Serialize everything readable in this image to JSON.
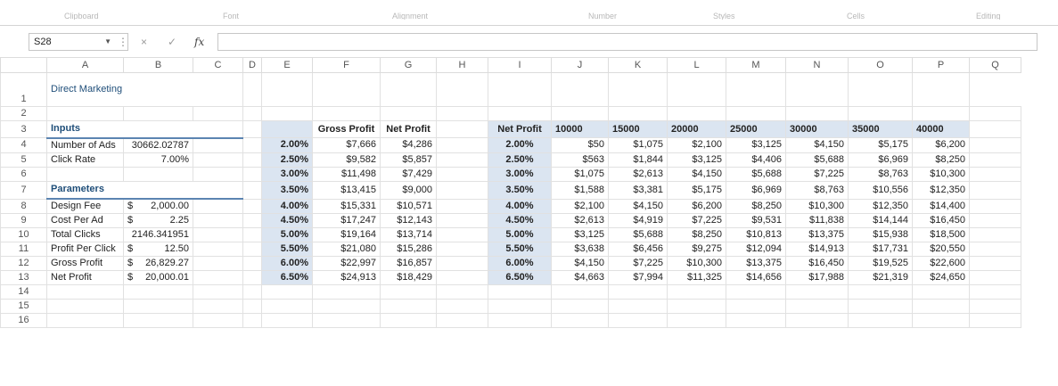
{
  "ribbon": {
    "groups": [
      "Clipboard",
      "Font",
      "Alignment",
      "Number",
      "Styles",
      "Cells",
      "Editing"
    ]
  },
  "formula_bar": {
    "name_box": "S28",
    "cancel_icon": "×",
    "enter_icon": "✓",
    "fx_label": "fx",
    "formula": ""
  },
  "columns": [
    "A",
    "B",
    "C",
    "D",
    "E",
    "F",
    "G",
    "H",
    "I",
    "J",
    "K",
    "L",
    "M",
    "N",
    "O",
    "P",
    "Q"
  ],
  "rows": [
    "1",
    "2",
    "3",
    "4",
    "5",
    "6",
    "7",
    "8",
    "9",
    "10",
    "11",
    "12",
    "13",
    "14",
    "15",
    "16"
  ],
  "title": "Direct Marketing",
  "inputs": {
    "heading": "Inputs",
    "items": [
      {
        "label": "Number of Ads",
        "currency": "",
        "value": "30662.02787"
      },
      {
        "label": "Click Rate",
        "currency": "",
        "value": "7.00%"
      }
    ]
  },
  "parameters": {
    "heading": "Parameters",
    "items": [
      {
        "label": "Design Fee",
        "currency": "$",
        "value": "2,000.00"
      },
      {
        "label": "Cost Per Ad",
        "currency": "$",
        "value": "2.25"
      },
      {
        "label": "Total Clicks",
        "currency": "",
        "value": "2146.341951"
      },
      {
        "label": "Profit Per Click",
        "currency": "$",
        "value": "12.50"
      },
      {
        "label": "Gross Profit",
        "currency": "$",
        "value": "26,829.27"
      },
      {
        "label": "Net Profit",
        "currency": "$",
        "value": "20,000.01"
      }
    ]
  },
  "one_way_table": {
    "headers": [
      "Gross Profit",
      "Net Profit"
    ],
    "rows": [
      {
        "rate": "2.00%",
        "gross": "$7,666",
        "net": "$4,286"
      },
      {
        "rate": "2.50%",
        "gross": "$9,582",
        "net": "$5,857"
      },
      {
        "rate": "3.00%",
        "gross": "$11,498",
        "net": "$7,429"
      },
      {
        "rate": "3.50%",
        "gross": "$13,415",
        "net": "$9,000"
      },
      {
        "rate": "4.00%",
        "gross": "$15,331",
        "net": "$10,571"
      },
      {
        "rate": "4.50%",
        "gross": "$17,247",
        "net": "$12,143"
      },
      {
        "rate": "5.00%",
        "gross": "$19,164",
        "net": "$13,714"
      },
      {
        "rate": "5.50%",
        "gross": "$21,080",
        "net": "$15,286"
      },
      {
        "rate": "6.00%",
        "gross": "$22,997",
        "net": "$16,857"
      },
      {
        "rate": "6.50%",
        "gross": "$24,913",
        "net": "$18,429"
      }
    ]
  },
  "two_way_table": {
    "corner": "Net Profit",
    "ads": [
      "10000",
      "15000",
      "20000",
      "25000",
      "30000",
      "35000",
      "40000"
    ],
    "rows": [
      {
        "rate": "2.00%",
        "values": [
          "$50",
          "$1,075",
          "$2,100",
          "$3,125",
          "$4,150",
          "$5,175",
          "$6,200"
        ]
      },
      {
        "rate": "2.50%",
        "values": [
          "$563",
          "$1,844",
          "$3,125",
          "$4,406",
          "$5,688",
          "$6,969",
          "$8,250"
        ]
      },
      {
        "rate": "3.00%",
        "values": [
          "$1,075",
          "$2,613",
          "$4,150",
          "$5,688",
          "$7,225",
          "$8,763",
          "$10,300"
        ]
      },
      {
        "rate": "3.50%",
        "values": [
          "$1,588",
          "$3,381",
          "$5,175",
          "$6,969",
          "$8,763",
          "$10,556",
          "$12,350"
        ]
      },
      {
        "rate": "4.00%",
        "values": [
          "$2,100",
          "$4,150",
          "$6,200",
          "$8,250",
          "$10,300",
          "$12,350",
          "$14,400"
        ]
      },
      {
        "rate": "4.50%",
        "values": [
          "$2,613",
          "$4,919",
          "$7,225",
          "$9,531",
          "$11,838",
          "$14,144",
          "$16,450"
        ]
      },
      {
        "rate": "5.00%",
        "values": [
          "$3,125",
          "$5,688",
          "$8,250",
          "$10,813",
          "$13,375",
          "$15,938",
          "$18,500"
        ]
      },
      {
        "rate": "5.50%",
        "values": [
          "$3,638",
          "$6,456",
          "$9,275",
          "$12,094",
          "$14,913",
          "$17,731",
          "$20,550"
        ]
      },
      {
        "rate": "6.00%",
        "values": [
          "$4,150",
          "$7,225",
          "$10,300",
          "$13,375",
          "$16,450",
          "$19,525",
          "$22,600"
        ]
      },
      {
        "rate": "6.50%",
        "values": [
          "$4,663",
          "$7,994",
          "$11,325",
          "$14,656",
          "$17,988",
          "$21,319",
          "$24,650"
        ]
      }
    ]
  },
  "colors": {
    "accent": "#1f4e79",
    "table_shade": "#dbe5f1",
    "gridline": "#e1e1e1"
  }
}
